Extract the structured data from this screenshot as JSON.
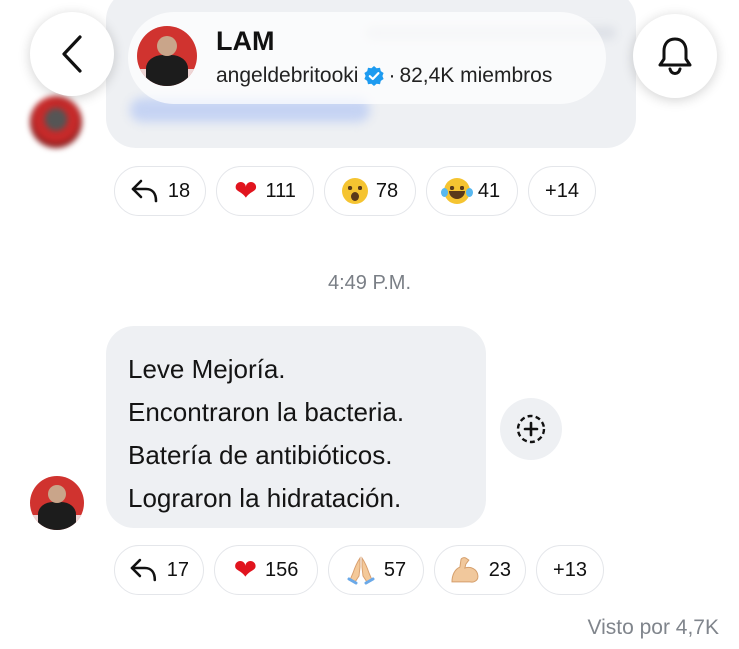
{
  "header": {
    "channel_name": "LAM",
    "username": "angeldebritooki",
    "separator": "·",
    "members": "82,4K miembros"
  },
  "previous_message": {
    "reactions": [
      {
        "icon": "reply-icon",
        "count": "18"
      },
      {
        "icon": "red-heart-emoji",
        "count": "111"
      },
      {
        "icon": "surprised-face-emoji",
        "count": "78"
      },
      {
        "icon": "tears-of-joy-emoji",
        "count": "41"
      },
      {
        "icon": "",
        "count": "+14"
      }
    ]
  },
  "timestamp": "4:49 P.M.",
  "message": {
    "lines": [
      "Leve Mejoría.",
      "Encontraron la bacteria.",
      "Batería de antibióticos.",
      "Lograron la hidratación."
    ],
    "reactions": [
      {
        "icon": "reply-icon",
        "count": "17"
      },
      {
        "icon": "red-heart-emoji",
        "count": "156"
      },
      {
        "icon": "folded-hands-emoji",
        "count": "57"
      },
      {
        "icon": "flexed-biceps-emoji",
        "count": "23"
      },
      {
        "icon": "",
        "count": "+13"
      }
    ]
  },
  "seen_by": "Visto por 4,7K",
  "colors": {
    "verified": "#1d9bf0",
    "heart": "#e1141e",
    "bubble": "#eef0f3",
    "muted_text": "#7a7f86"
  }
}
